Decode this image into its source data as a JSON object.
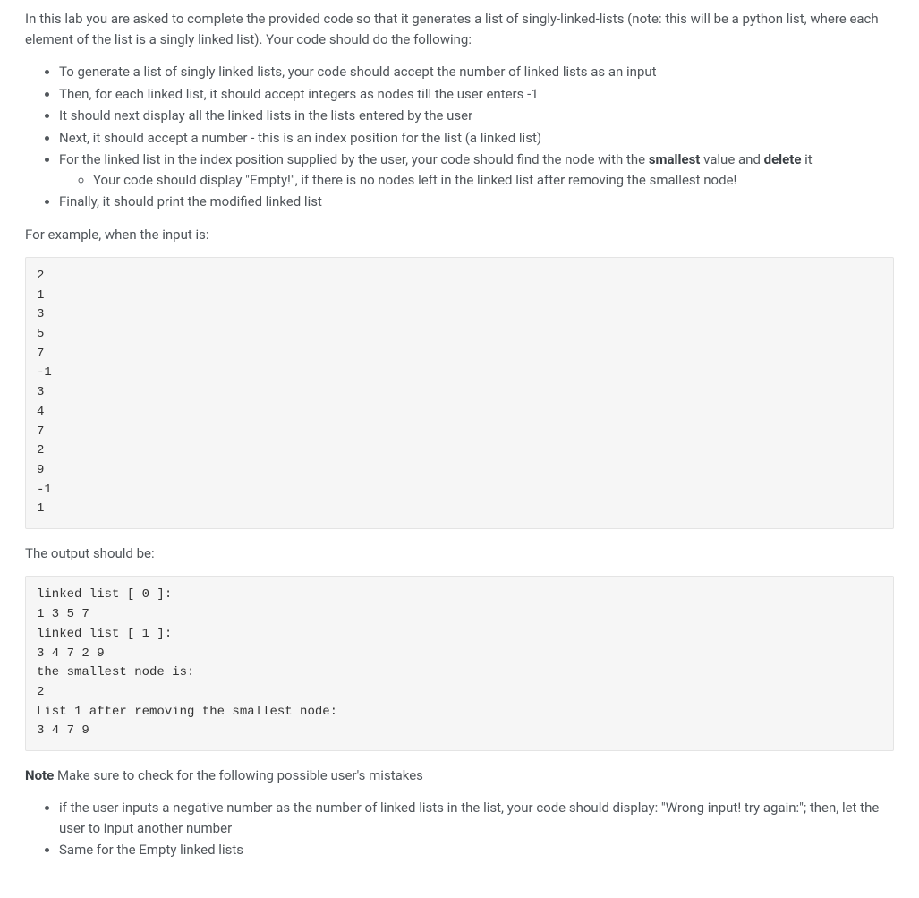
{
  "intro": "In this lab you are asked to complete the provided code so that it generates a list of singly-linked-lists (note: this will be a python list, where each element of the list is a singly linked list). Your code should do the following:",
  "bullets": [
    "To generate a list of singly linked lists, your code should accept the number of linked lists as an input",
    "Then, for each linked list, it should accept integers as nodes till the user enters -1",
    "It should next display all the linked lists in the lists entered by the user",
    "Next, it should accept a number - this is an index position for the list (a linked list)"
  ],
  "bullet5_prefix": "For the linked list in the index position supplied by the user, your code should find the node with the ",
  "bullet5_strong1": "smallest",
  "bullet5_mid": " value and ",
  "bullet5_strong2": "delete",
  "bullet5_suffix": " it",
  "subbullet": "Your code should display \"Empty!\", if there is no nodes left in the linked list after removing the smallest node!",
  "bullet6": "Finally, it should print the modified linked list",
  "example_label": "For example, when the input is:",
  "input_block": "2\n1\n3\n5\n7\n-1\n3\n4\n7\n2\n9\n-1\n1",
  "output_label": "The output should be:",
  "output_block": "linked list [ 0 ]:\n1 3 5 7\nlinked list [ 1 ]:\n3 4 7 2 9\nthe smallest node is:\n2\nList 1 after removing the smallest node:\n3 4 7 9",
  "note_label": "Note",
  "note_text": " Make sure to check for the following possible user's mistakes",
  "note_bullets": [
    "if the user inputs a negative number as the number of linked lists in the list, your code should display: \"Wrong input! try again:\"; then, let the user to input another number",
    "Same for the Empty linked lists"
  ]
}
